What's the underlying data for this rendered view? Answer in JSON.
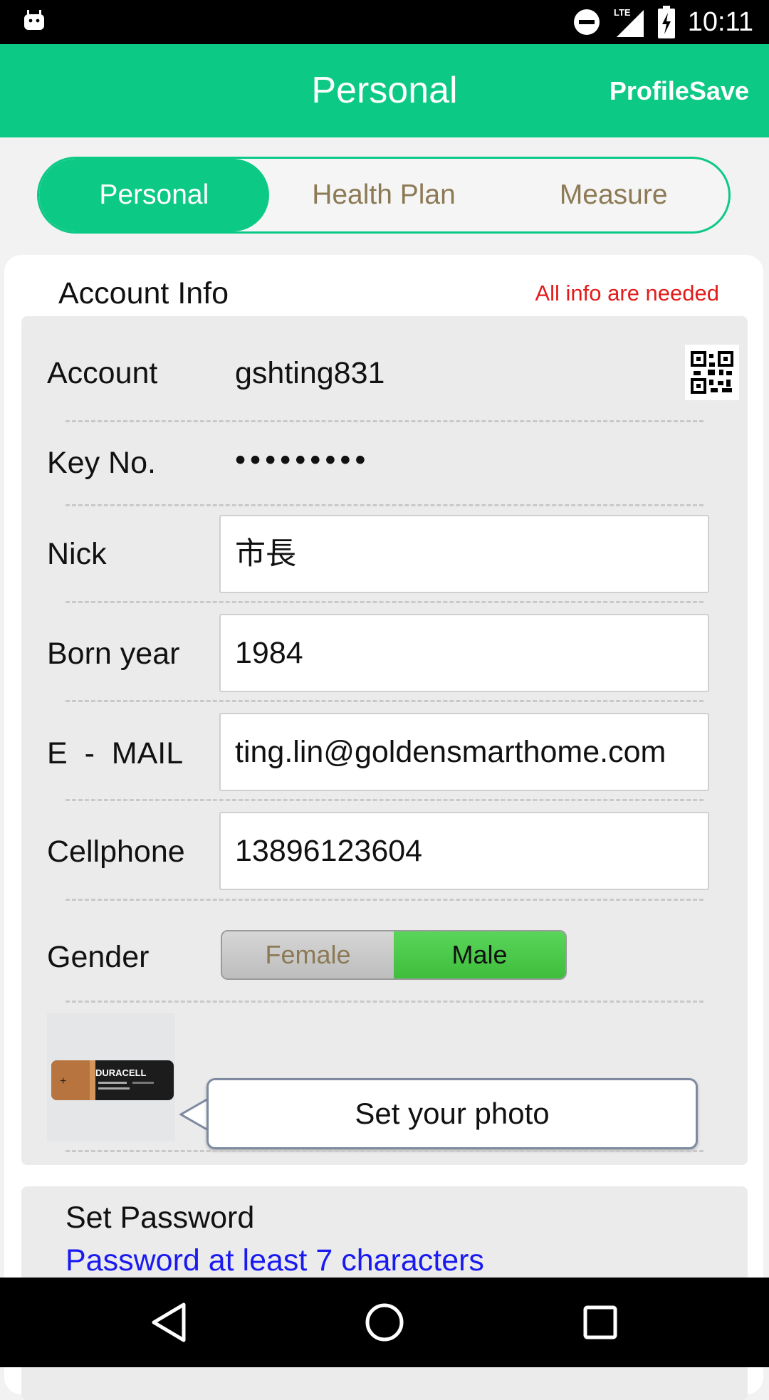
{
  "status_bar": {
    "time": "10:11",
    "network": "LTE",
    "icons": [
      "android-icon",
      "do-not-disturb-icon",
      "lte-signal-icon",
      "battery-charging-icon"
    ]
  },
  "app_bar": {
    "title": "Personal",
    "action_label": "ProfileSave"
  },
  "tabs": [
    {
      "label": "Personal",
      "active": true
    },
    {
      "label": "Health Plan",
      "active": false
    },
    {
      "label": "Measure",
      "active": false
    }
  ],
  "account_info": {
    "title": "Account Info",
    "required_note": "All info are needed",
    "account_label": "Account",
    "account_value": "gshting831",
    "key_label": "Key No.",
    "key_value": "•••••••••",
    "nick_label": "Nick",
    "nick_value": "市長",
    "born_label": "Born year",
    "born_value": "1984",
    "email_label": "E  -  MAIL",
    "email_value": "ting.lin@goldensmarthome.com",
    "cellphone_label": "Cellphone",
    "cellphone_value": "13896123604",
    "gender_label": "Gender",
    "gender_options": [
      "Female",
      "Male"
    ],
    "gender_selected": "Male",
    "photo_brand_text": "DURACELL",
    "photo_button_label": "Set your photo"
  },
  "password": {
    "title": "Set Password",
    "hint": "Password at least 7 characters"
  },
  "colors": {
    "accent": "#0dc986",
    "warning": "#e31b1b",
    "link": "#1a1af0",
    "gender_selected": "#4ccb4a"
  },
  "nav_bar": {
    "icons": [
      "back-icon",
      "home-icon",
      "recents-icon"
    ]
  }
}
